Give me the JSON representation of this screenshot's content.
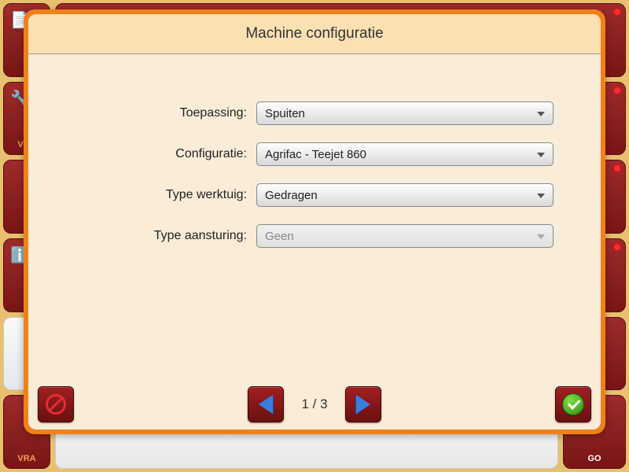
{
  "background": {
    "tiles": [
      {
        "label": "VRA"
      },
      {
        "label": ""
      },
      {
        "label": ""
      },
      {
        "label": "GO"
      }
    ]
  },
  "modal": {
    "title": "Machine configuratie",
    "fields": {
      "application": {
        "label": "Toepassing:",
        "value": "Spuiten",
        "enabled": true
      },
      "configuration": {
        "label": "Configuratie:",
        "value": "Agrifac - Teejet 860",
        "enabled": true
      },
      "implement_type": {
        "label": "Type werktuig:",
        "value": "Gedragen",
        "enabled": true
      },
      "control_type": {
        "label": "Type aansturing:",
        "value": "Geen",
        "enabled": false
      }
    },
    "pager": {
      "text": "1 / 3",
      "current": 1,
      "total": 3
    }
  }
}
